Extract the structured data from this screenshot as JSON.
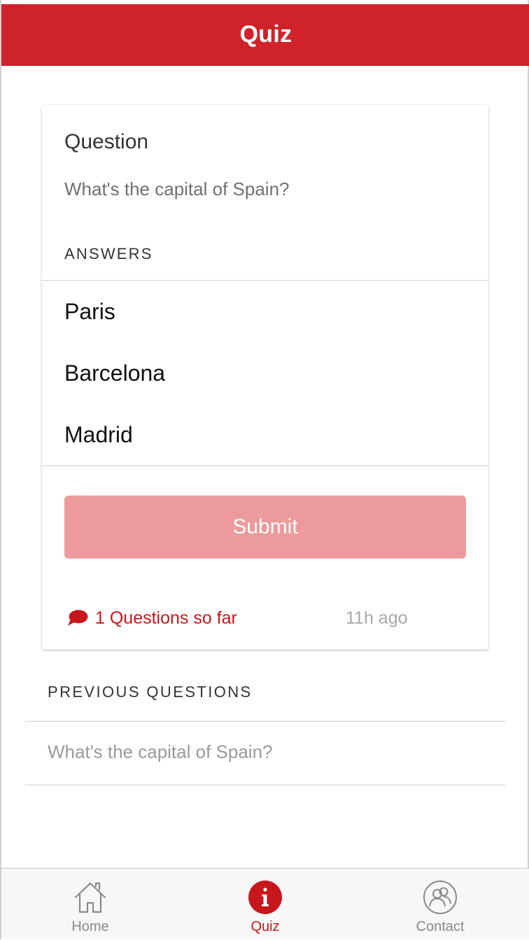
{
  "header": {
    "title": "Quiz"
  },
  "card": {
    "title": "Question",
    "question": "What's the capital of Spain?",
    "answers_header": "ANSWERS",
    "answers": [
      {
        "label": "Paris"
      },
      {
        "label": "Barcelona"
      },
      {
        "label": "Madrid"
      }
    ],
    "submit_label": "Submit",
    "questions_count": "1 Questions so far",
    "time_ago": "11h ago"
  },
  "previous": {
    "header": "PREVIOUS QUESTIONS",
    "items": [
      {
        "label": "What's the capital of Spain?"
      }
    ]
  },
  "tab_bar": {
    "tabs": [
      {
        "label": "Home",
        "icon": "home-icon",
        "active": false
      },
      {
        "label": "Quiz",
        "icon": "info-icon",
        "active": true
      },
      {
        "label": "Contact",
        "icon": "contact-icon",
        "active": false
      }
    ]
  },
  "colors": {
    "primary": "#d0222a",
    "submit_disabled": "#ec9a9b",
    "accent_text": "#c8171c",
    "muted_text": "#a8a8a8"
  }
}
